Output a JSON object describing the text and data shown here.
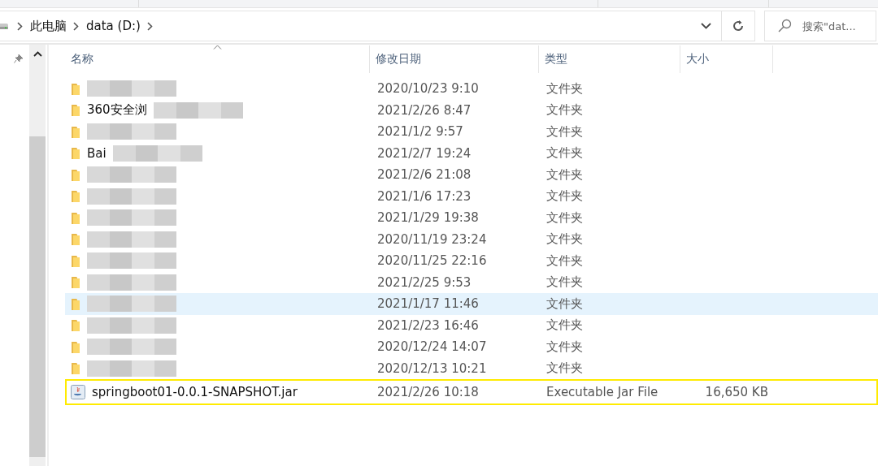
{
  "address_bar": {
    "crumbs": [
      "此电脑",
      "data (D:)"
    ]
  },
  "search": {
    "placeholder": "搜索\"dat..."
  },
  "columns": [
    {
      "label": "名称",
      "sorted": true
    },
    {
      "label": "修改日期",
      "sorted": false
    },
    {
      "label": "类型",
      "sorted": false
    },
    {
      "label": "大小",
      "sorted": false
    }
  ],
  "rows": [
    {
      "kind": "folder",
      "obscured": true,
      "modified": "2020/10/23 9:10",
      "type": "文件夹",
      "selected": false,
      "highlighted": false
    },
    {
      "kind": "folder",
      "name": "360安全浏",
      "obscured": true,
      "modified": "2021/2/26 8:47",
      "type": "文件夹",
      "selected": false,
      "highlighted": false
    },
    {
      "kind": "folder",
      "obscured": true,
      "modified": "2021/1/2 9:57",
      "type": "文件夹",
      "selected": false,
      "highlighted": false
    },
    {
      "kind": "folder",
      "name": "Bai",
      "obscured": true,
      "modified": "2021/2/7 19:24",
      "type": "文件夹",
      "selected": false,
      "highlighted": false
    },
    {
      "kind": "folder",
      "obscured": true,
      "modified": "2021/2/6 21:08",
      "type": "文件夹",
      "selected": false,
      "highlighted": false
    },
    {
      "kind": "folder",
      "obscured": true,
      "modified": "2021/1/6 17:23",
      "type": "文件夹",
      "selected": false,
      "highlighted": false
    },
    {
      "kind": "folder",
      "obscured": true,
      "modified": "2021/1/29 19:38",
      "type": "文件夹",
      "selected": false,
      "highlighted": false
    },
    {
      "kind": "folder",
      "obscured": true,
      "modified": "2020/11/19 23:24",
      "type": "文件夹",
      "selected": false,
      "highlighted": false
    },
    {
      "kind": "folder",
      "obscured": true,
      "modified": "2020/11/25 22:16",
      "type": "文件夹",
      "selected": false,
      "highlighted": false
    },
    {
      "kind": "folder",
      "obscured": true,
      "modified": "2021/2/25 9:53",
      "type": "文件夹",
      "selected": false,
      "highlighted": false
    },
    {
      "kind": "folder",
      "obscured": true,
      "modified": "2021/1/17 11:46",
      "type": "文件夹",
      "selected": true,
      "highlighted": false
    },
    {
      "kind": "folder",
      "obscured": true,
      "modified": "2021/2/23 16:46",
      "type": "文件夹",
      "selected": false,
      "highlighted": false
    },
    {
      "kind": "folder",
      "obscured": true,
      "modified": "2020/12/24 14:07",
      "type": "文件夹",
      "selected": false,
      "highlighted": false
    },
    {
      "kind": "folder",
      "obscured": true,
      "modified": "2020/12/13 10:21",
      "type": "文件夹",
      "selected": false,
      "highlighted": false
    },
    {
      "kind": "jar",
      "name": "springboot01-0.0.1-SNAPSHOT.jar",
      "obscured": false,
      "modified": "2021/2/26 10:18",
      "type": "Executable Jar File",
      "size": "16,650 KB",
      "selected": false,
      "highlighted": true
    }
  ]
}
